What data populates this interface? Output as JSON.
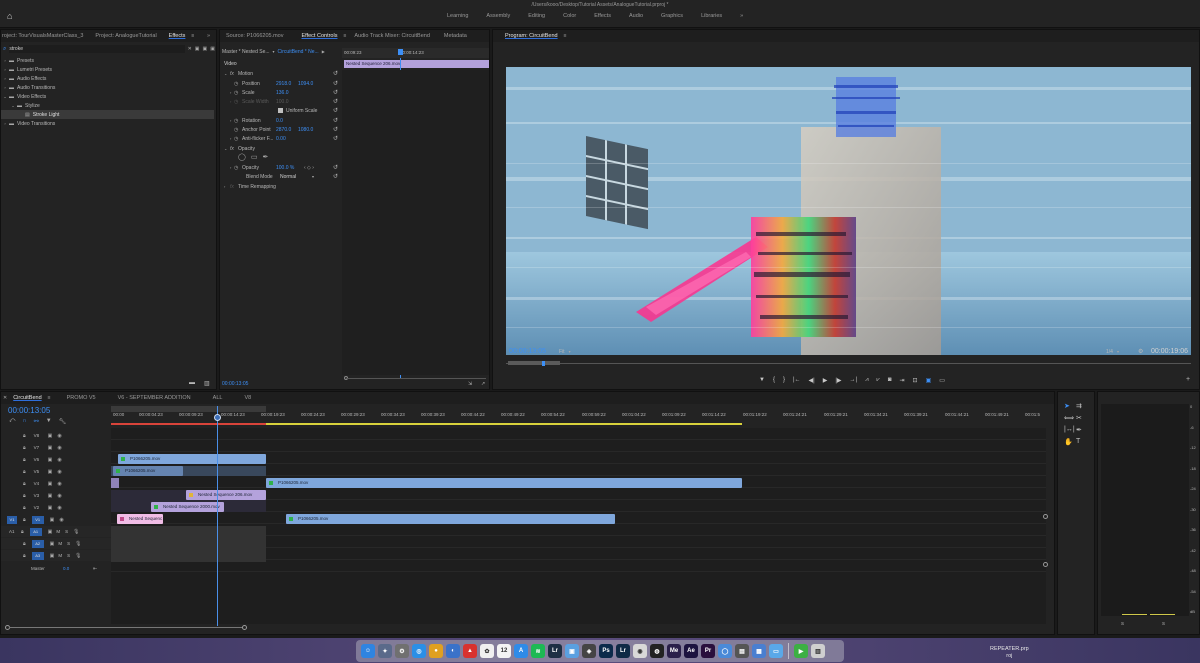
{
  "app": {
    "file_path": "/Users/kooo/Desktop/Tutorial Assets/AnalogueTutorial.prproj *",
    "workspaces": [
      "Learning",
      "Assembly",
      "Editing",
      "Color",
      "Effects",
      "Audio",
      "Graphics",
      "Libraries"
    ],
    "workspace_more": "»"
  },
  "project_panel": {
    "tabs": [
      "roject: TourVisualsMasterClass_3",
      "Project: AnalogueTutorial",
      "Effects"
    ],
    "more": "»",
    "search_value": "stroke",
    "tree": [
      {
        "label": "Presets",
        "level": 0
      },
      {
        "label": "Lumetri Presets",
        "level": 0
      },
      {
        "label": "Audio Effects",
        "level": 0
      },
      {
        "label": "Audio Transitions",
        "level": 0
      },
      {
        "label": "Video Effects",
        "level": 0
      },
      {
        "label": "Stylize",
        "level": 1
      },
      {
        "label": "Stroke Light",
        "level": 2
      },
      {
        "label": "Video Transitions",
        "level": 0
      }
    ]
  },
  "effect_controls": {
    "tabs": [
      "Source: P1066205.mov",
      "Effect Controls",
      "Audio Track Mixer: CircuitBend",
      "Metadata"
    ],
    "master_label": "Master * Nested Se...",
    "sequence_label": "CircuitBend * Ne...",
    "mini_times": [
      "00:09:23",
      "00:00:14:23"
    ],
    "clip_bar": "Nested Sequence 206.mov",
    "section_video": "Video",
    "rows": [
      {
        "label": "Motion",
        "kind": "fx"
      },
      {
        "label": "Position",
        "v1": "2918.0",
        "v2": "1094.0"
      },
      {
        "label": "Scale",
        "v1": "136.0",
        "v2": ""
      },
      {
        "label": "Scale Width",
        "v1": "100.0",
        "v2": "",
        "dim": true
      },
      {
        "label": "Uniform Scale",
        "kind": "check"
      },
      {
        "label": "Rotation",
        "v1": "0.0",
        "v2": ""
      },
      {
        "label": "Anchor Point",
        "v1": "2870.0",
        "v2": "1080.0"
      },
      {
        "label": "Anti-flicker F...",
        "v1": "0.00",
        "v2": ""
      },
      {
        "label": "Opacity",
        "kind": "fx"
      },
      {
        "label": "",
        "kind": "masks"
      },
      {
        "label": "Opacity",
        "v1": "100.0 %",
        "v2": ""
      },
      {
        "label": "Blend Mode",
        "v1": "Normal",
        "v2": ""
      },
      {
        "label": "Time Remapping",
        "kind": "fx"
      }
    ],
    "timecode": "00:00:13:05"
  },
  "program": {
    "title": "Program: CircuitBend",
    "timecode": "00:00:13:05",
    "fit": "Fit",
    "resolution": "1/4",
    "duration": "00:00:19:06"
  },
  "timeline": {
    "tabs": [
      "CircuitBend",
      "PROMO V5",
      "V6 - SEPTEMBER ADDITION",
      "ALL",
      "V8"
    ],
    "timecode": "00:00:13:05",
    "ruler": [
      "00:00",
      "00:00:04:23",
      "00:00:09:23",
      "00:00:14:23",
      "00:00:19:23",
      "00:00:24:23",
      "00:00:29:23",
      "00:00:34:23",
      "00:00:39:23",
      "00:00:44:22",
      "00:00:49:22",
      "00:00:54:22",
      "00:00:59:22",
      "00:01:04:22",
      "00:01:09:22",
      "00:01:14:22",
      "00:01:19:22",
      "00:01:24:21",
      "00:01:29:21",
      "00:01:34:21",
      "00:01:39:21",
      "00:01:44:21",
      "00:01:49:21",
      "00:01:5"
    ],
    "tracks": [
      "V8",
      "V7",
      "V6",
      "V5",
      "V4",
      "V3",
      "V2",
      "V1",
      "A1",
      "A2",
      "A3"
    ],
    "master": {
      "label": "Master",
      "value": "0.0"
    },
    "clips": [
      {
        "label": "P1066205.mov",
        "kind": "video"
      },
      {
        "label": "P1066205.mov",
        "kind": "video"
      },
      {
        "label": "P1066205.mov",
        "kind": "video"
      },
      {
        "label": "Nested Sequence 206.mov",
        "kind": "nested"
      },
      {
        "label": "Nested Sequence 2000.mov",
        "kind": "nested"
      },
      {
        "label": "Nested Sequenc",
        "kind": "pink"
      },
      {
        "label": "P1066205.mov",
        "kind": "video"
      }
    ]
  },
  "audio_meter": {
    "scale": [
      "0",
      "-6",
      "-12",
      "-18",
      "-24",
      "-30",
      "-36",
      "-42",
      "-48",
      "-54",
      "dB"
    ],
    "channels": [
      "S",
      "S"
    ]
  },
  "dock": {
    "badge_label": "REPEATER.prp",
    "badge_sub": "roj",
    "icons": [
      {
        "name": "finder-icon",
        "color": "#2f84e0",
        "glyph": "☺"
      },
      {
        "name": "launchpad-icon",
        "color": "#5a6a8a",
        "glyph": "✦"
      },
      {
        "name": "system-prefs-icon",
        "color": "#707070",
        "glyph": "⚙"
      },
      {
        "name": "safari-icon",
        "color": "#2b8fe6",
        "glyph": "◎"
      },
      {
        "name": "chrome-icon",
        "color": "#e0a020",
        "glyph": "●"
      },
      {
        "name": "disk-utility-icon",
        "color": "#3a72c9",
        "glyph": "◐"
      },
      {
        "name": "app-red-icon",
        "color": "#d8322f",
        "glyph": "▲"
      },
      {
        "name": "photos-icon",
        "color": "#f0f0f0",
        "glyph": "✿"
      },
      {
        "name": "calendar-icon",
        "color": "#f4f4f4",
        "glyph": "12"
      },
      {
        "name": "app-store-icon",
        "color": "#2f8be8",
        "glyph": "A"
      },
      {
        "name": "spotify-icon",
        "color": "#1db954",
        "glyph": "≋"
      },
      {
        "name": "lightroom-classic-icon",
        "color": "#1d2f44",
        "glyph": "Lr"
      },
      {
        "name": "preview-icon",
        "color": "#5aa0e0",
        "glyph": "▣"
      },
      {
        "name": "app-icon",
        "color": "#444",
        "glyph": "◈"
      },
      {
        "name": "photoshop-icon",
        "color": "#0b2a4a",
        "glyph": "Ps"
      },
      {
        "name": "lightroom-icon",
        "color": "#0f2a45",
        "glyph": "Lr"
      },
      {
        "name": "screen-recorder-icon",
        "color": "#d8d8d8",
        "glyph": "◉"
      },
      {
        "name": "app-dark-icon",
        "color": "#222",
        "glyph": "◍"
      },
      {
        "name": "media-encoder-icon",
        "color": "#2a1f4a",
        "glyph": "Me"
      },
      {
        "name": "after-effects-icon",
        "color": "#1c1340",
        "glyph": "Ae"
      },
      {
        "name": "premiere-icon",
        "color": "#2a0f3d",
        "glyph": "Pr"
      },
      {
        "name": "app-light-icon",
        "color": "#4a8ad8",
        "glyph": "◯"
      },
      {
        "name": "clapper-icon",
        "color": "#555",
        "glyph": "▤"
      },
      {
        "name": "preview-doc-icon",
        "color": "#4a7fd0",
        "glyph": "▦"
      },
      {
        "name": "folder-icon",
        "color": "#5aa8e8",
        "glyph": "▭"
      },
      {
        "name": "facetime-icon",
        "color": "#3cb043",
        "glyph": "▶"
      },
      {
        "name": "trash-icon",
        "color": "#cfcfcf",
        "glyph": "▥"
      }
    ]
  }
}
